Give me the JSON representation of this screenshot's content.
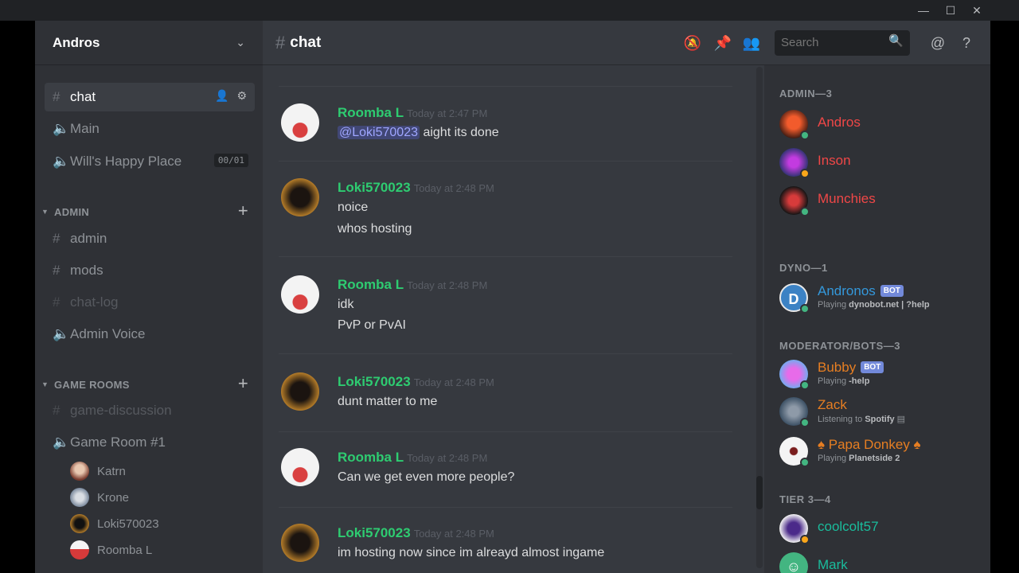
{
  "window": {
    "min": "—",
    "max": "☐",
    "close": "✕"
  },
  "server": {
    "name": "Andros"
  },
  "channels": {
    "top": [
      {
        "label": "chat",
        "sym": "#"
      },
      {
        "label": "Main",
        "sym": "🔈"
      },
      {
        "label": "Will's Happy Place",
        "sym": "🔈",
        "count": "00/01"
      }
    ],
    "admin_label": "ADMIN",
    "admin": [
      {
        "label": "admin",
        "sym": "#"
      },
      {
        "label": "mods",
        "sym": "#"
      },
      {
        "label": "chat-log",
        "sym": "#"
      },
      {
        "label": "Admin Voice",
        "sym": "🔈"
      }
    ],
    "games_label": "GAME ROOMS",
    "games": [
      {
        "label": "game-discussion",
        "sym": "#"
      },
      {
        "label": "Game Room #1",
        "sym": "🔈"
      }
    ],
    "voice_users": [
      "Katrn",
      "Krone",
      "Loki570023",
      "Roomba L"
    ]
  },
  "chat": {
    "title": "chat",
    "search_placeholder": "Search",
    "messages": [
      {
        "author": "Roomba L",
        "time": "Today at 2:47 PM",
        "mention": "@Loki570023",
        "lines": [
          "aight its done"
        ]
      },
      {
        "author": "Loki570023",
        "time": "Today at 2:48 PM",
        "lines": [
          "noice",
          "whos hosting"
        ]
      },
      {
        "author": "Roomba L",
        "time": "Today at 2:48 PM",
        "lines": [
          "idk",
          "PvP or PvAI"
        ]
      },
      {
        "author": "Loki570023",
        "time": "Today at 2:48 PM",
        "lines": [
          "dunt matter to me"
        ]
      },
      {
        "author": "Roomba L",
        "time": "Today at 2:48 PM",
        "lines": [
          "Can we get even more people?"
        ]
      },
      {
        "author": "Loki570023",
        "time": "Today at 2:48 PM",
        "lines": [
          "im hosting now since im alreayd almost ingame"
        ]
      }
    ]
  },
  "members": {
    "admin_role": "ADMIN—3",
    "admin": [
      {
        "name": "Andros",
        "color": "#f04747"
      },
      {
        "name": "Inson",
        "color": "#f04747"
      },
      {
        "name": "Munchies",
        "color": "#f04747"
      }
    ],
    "dyno_role": "DYNO—1",
    "dyno": [
      {
        "name": "Andronos",
        "tag": "BOT",
        "activity": "Playing",
        "activity_bold": "dynobot.net | ?help",
        "color": "#3498db"
      }
    ],
    "mod_role": "MODERATOR/BOTS—3",
    "mods": [
      {
        "name": "Bubby",
        "tag": "BOT",
        "activity": "Playing",
        "activity_bold": "-help",
        "color": "#e67e22"
      },
      {
        "name": "Zack",
        "activity": "Listening to",
        "activity_bold": "Spotify",
        "color": "#e67e22"
      },
      {
        "name": "♠ Papa Donkey ♠",
        "activity": "Playing",
        "activity_bold": "Planetside 2",
        "color": "#e67e22"
      }
    ],
    "tier_role": "TIER 3—4",
    "tier": [
      {
        "name": "coolcolt57",
        "color": "#1abc9c"
      },
      {
        "name": "Mark",
        "color": "#1abc9c"
      }
    ]
  },
  "colors": {
    "bg_chat": "#36393f",
    "bg_side": "#2f3136",
    "online": "#43b581",
    "idle": "#faa61a"
  }
}
